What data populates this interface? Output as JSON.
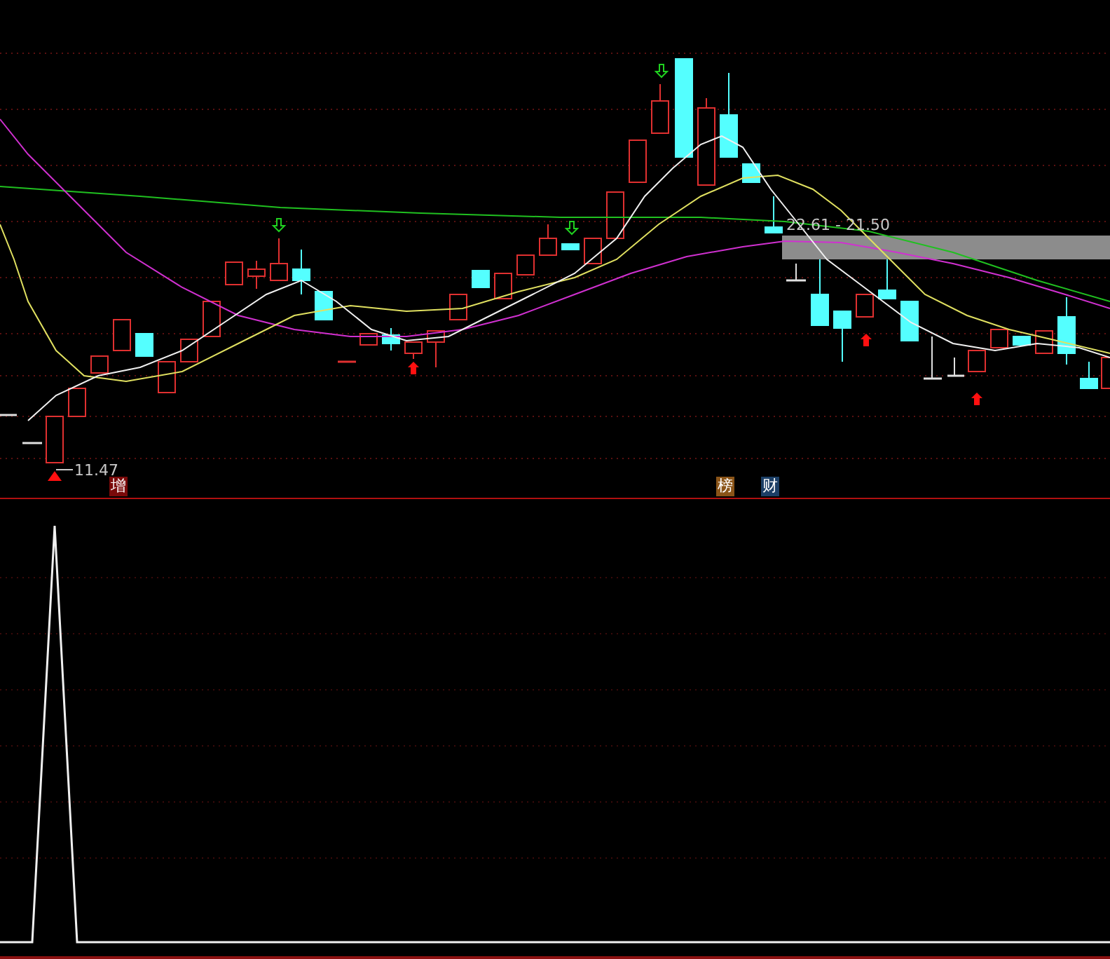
{
  "price_chart": {
    "low_label": "11.47",
    "range_label": "22.61 - 21.50",
    "badges": [
      {
        "text": "增",
        "color": "#7a0a0a"
      },
      {
        "text": "榜",
        "color": "#8a5418"
      },
      {
        "text": "财",
        "color": "#1c3f66"
      }
    ]
  }
}
